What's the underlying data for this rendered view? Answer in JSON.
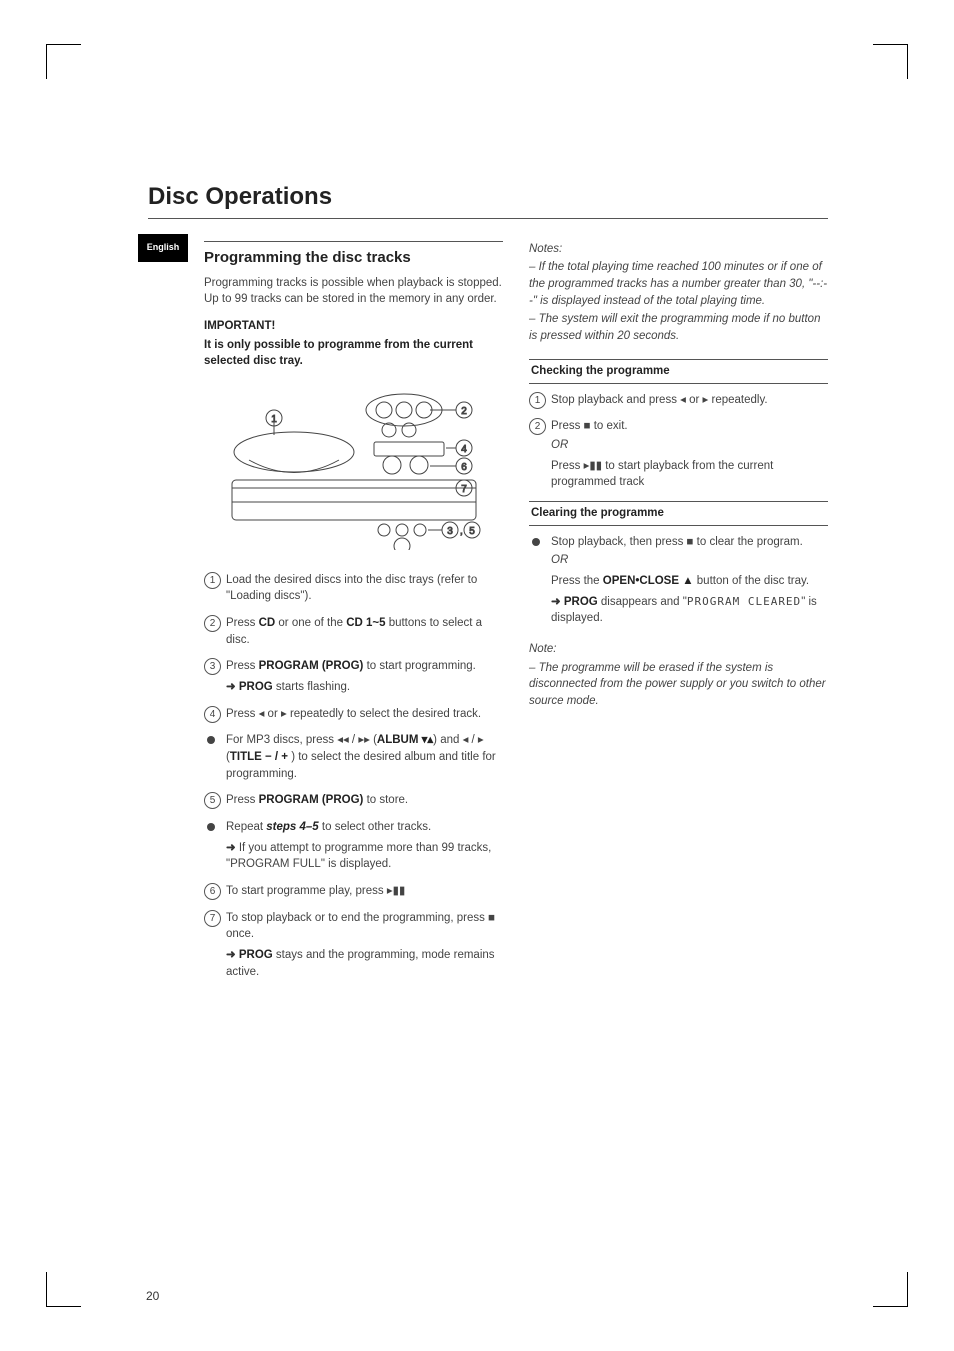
{
  "page_number": "20",
  "side_tab": "English",
  "section_title": "Disc Operations",
  "left": {
    "heading": "Programming the disc tracks",
    "intro": "Programming tracks is possible when playback is stopped.  Up to 99 tracks can be stored in the memory in any order.",
    "important_label": "IMPORTANT!",
    "important_text": "It is only possible to programme from the current selected disc tray.",
    "steps": {
      "s1": "Load the desired discs into the disc trays (refer to \"Loading discs\").",
      "s2a": "Press ",
      "s2b": "CD",
      "s2c": " or one of the ",
      "s2d": "CD 1~5",
      "s2e": " buttons to select a disc.",
      "s3a": "Press ",
      "s3b": "PROGRAM (PROG)",
      "s3c": " to start programming.",
      "s3_result_label": "PROG",
      "s3_result_text": " starts flashing.",
      "s4": "Press  ◂  or  ▸  repeatedly to select the desired track.",
      "b1a": "For MP3 discs, press  ◂◂ / ▸▸  (",
      "b1b": "ALBUM ▾▴",
      "b1c": ") and  ◂ / ▸  (",
      "b1d": "TITLE − / +",
      "b1e": " ) to select the desired album and title for programming.",
      "s5a": "Press ",
      "s5b": "PROGRAM (PROG)",
      "s5c": " to store.",
      "b2a": "Repeat ",
      "b2b": "steps 4–5",
      "b2c": " to select other tracks.",
      "b2_result": "If you attempt to programme more than 99 tracks, \"PROGRAM FULL\" is displayed.",
      "s6": "To start programme play, press  ▸▮▮",
      "s7": "To stop playback or to end the programming, press  ■  once.",
      "s7_result_label": "PROG",
      "s7_result_text": " stays and the programming, mode remains active."
    }
  },
  "right": {
    "notes_label": "Notes:",
    "note1": "–  If the total playing time reached 100 minutes or if one of the programmed tracks has a number greater than 30, \"--:--\" is displayed instead of the total playing time.",
    "note2": "–  The system will exit the programming mode if no button is pressed within 20 seconds.",
    "check_heading": "Checking the programme",
    "check_s1": "Stop playback and press  ◂  or  ▸  repeatedly.",
    "check_s2a": "Press  ■  to exit.",
    "check_or": "OR",
    "check_s2b": "Press  ▸▮▮ to start playback from the current programmed track",
    "clear_heading": "Clearing the programme",
    "clear_b1": "Stop playback, then press  ■  to clear the program.",
    "clear_or": "OR",
    "clear_b1b_a": "Press the ",
    "clear_b1b_b": "OPEN•CLOSE ▲",
    "clear_b1b_c": " button of the disc tray.",
    "clear_result_label": "PROG",
    "clear_result_text_a": " disappears and \"",
    "clear_result_disp": "PROGRAM CLEARED",
    "clear_result_text_b": "\" is displayed.",
    "note_label": "Note:",
    "clear_note": "–  The programme will be erased if the system is disconnected from the power supply or you switch to other source mode."
  }
}
